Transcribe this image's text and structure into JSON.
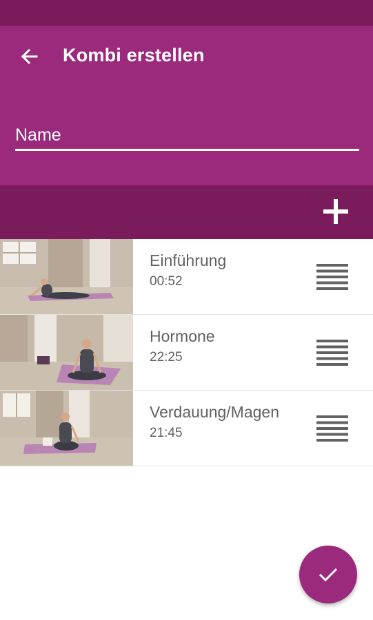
{
  "app_bar": {
    "title": "Kombi erstellen",
    "back_icon": "arrow-left-icon"
  },
  "name_field": {
    "placeholder": "Name",
    "value": ""
  },
  "toolbar": {
    "add_icon": "plus-icon"
  },
  "exercises": [
    {
      "title": "Einführung",
      "duration": "00:52",
      "drag_icon": "drag-handle-icon"
    },
    {
      "title": "Hormone",
      "duration": "22:25",
      "drag_icon": "drag-handle-icon"
    },
    {
      "title": "Verdauung/Magen",
      "duration": "21:45",
      "drag_icon": "drag-handle-icon"
    }
  ],
  "fab": {
    "icon": "check-icon"
  },
  "colors": {
    "primary": "#9b2a7c",
    "primary_dark": "#7a1c5c",
    "text_secondary": "#616161"
  }
}
